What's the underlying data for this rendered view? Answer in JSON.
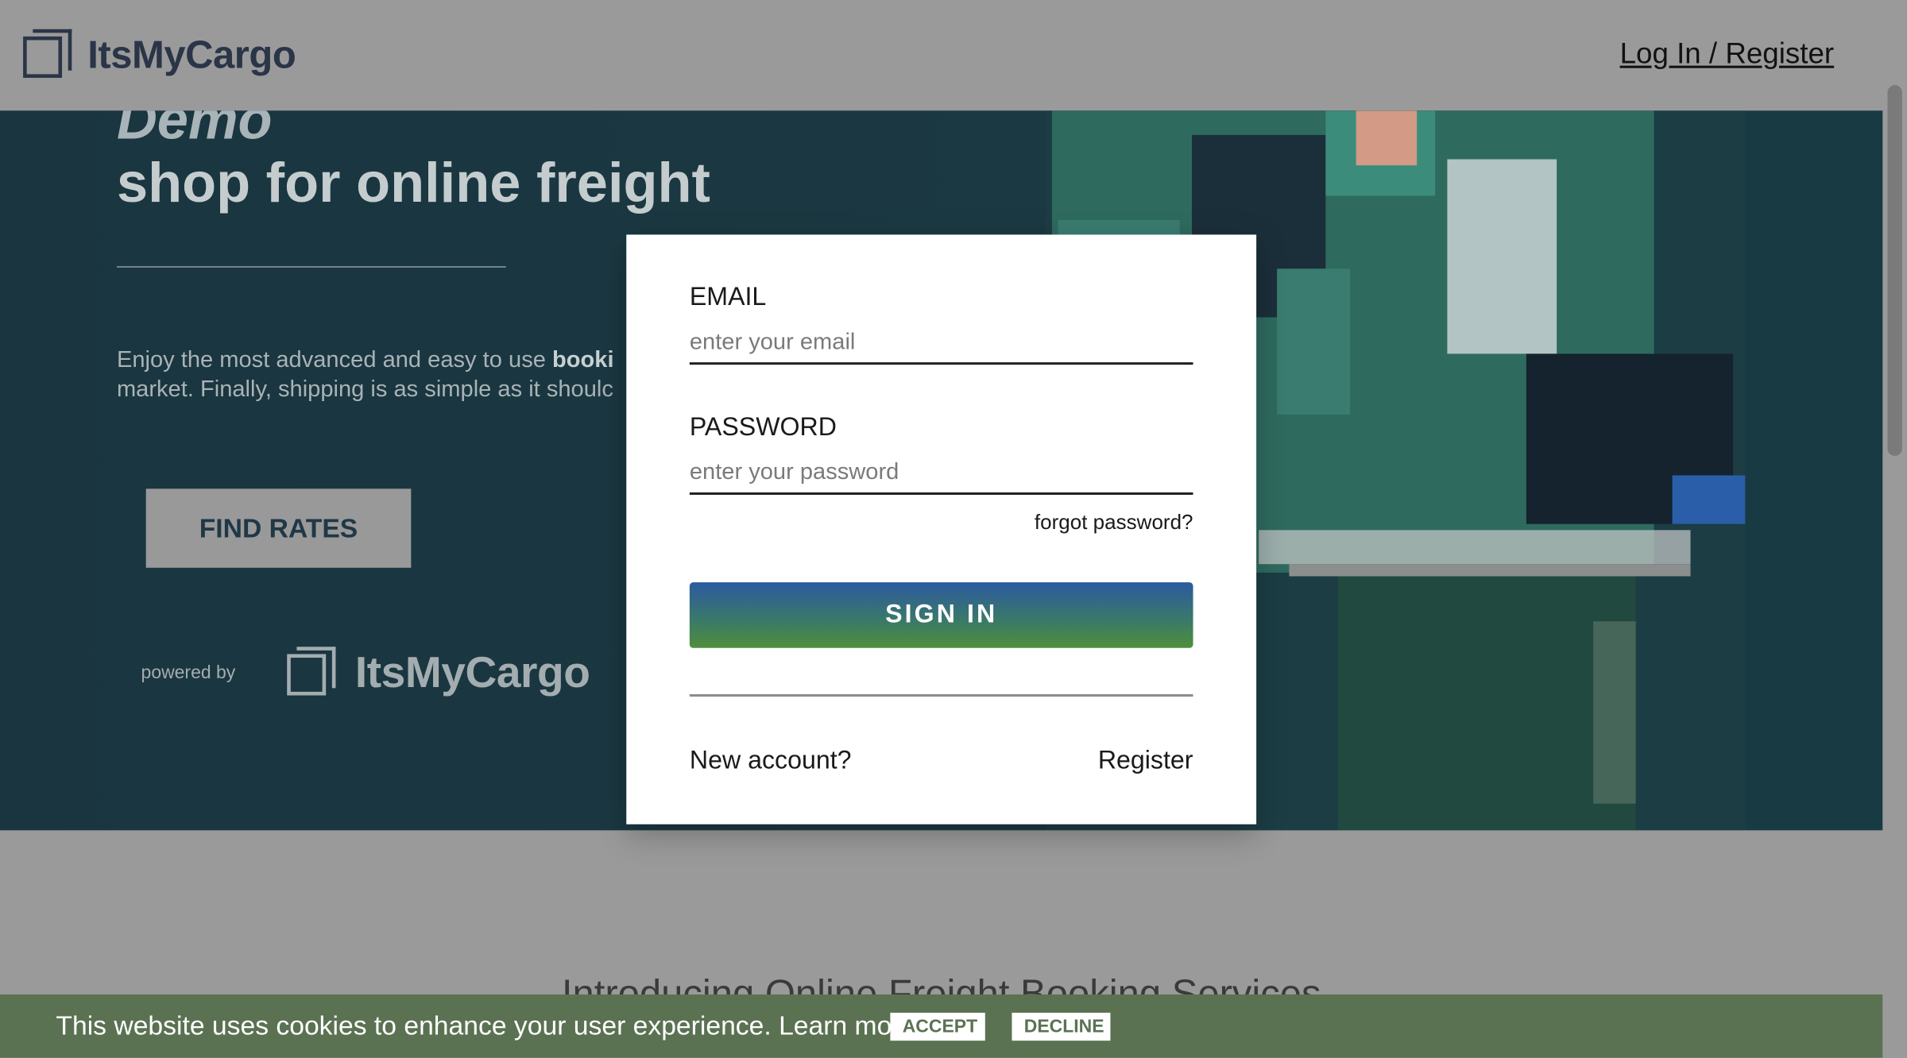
{
  "header": {
    "brand": "ItsMyCargo",
    "login_label": "Log In / Register"
  },
  "hero": {
    "demo_label": "Demo",
    "title": "shop for online freight",
    "desc_prefix": "Enjoy the most advanced and easy to use ",
    "desc_bold": "booki",
    "desc_line2": "market. Finally, shipping is as simple as it shoulc",
    "find_rates_label": "FIND RATES",
    "powered_by": "powered by",
    "powered_brand": "ItsMyCargo"
  },
  "login_modal": {
    "email_label": "EMAIL",
    "email_placeholder": "enter your email",
    "password_label": "PASSWORD",
    "password_placeholder": "enter your password",
    "forgot_label": "forgot password?",
    "signin_label": "SIGN IN",
    "new_account_label": "New account?",
    "register_label": "Register"
  },
  "lower": {
    "intro_heading": "Introducing Online Freight Booking Services"
  },
  "cookie_bar": {
    "text": "This website uses cookies to enhance your user experience. Learn more",
    "accept_label": "ACCEPT",
    "decline_label": "DECLINE"
  },
  "colors": {
    "header_bg": "#9a9a9a",
    "hero_bg": "#1a3540",
    "cookie_bg": "#5b7252",
    "brand_text": "#2b3548",
    "signin_gradient_top": "#2c5aa0",
    "signin_gradient_bottom": "#4f8f3c"
  }
}
